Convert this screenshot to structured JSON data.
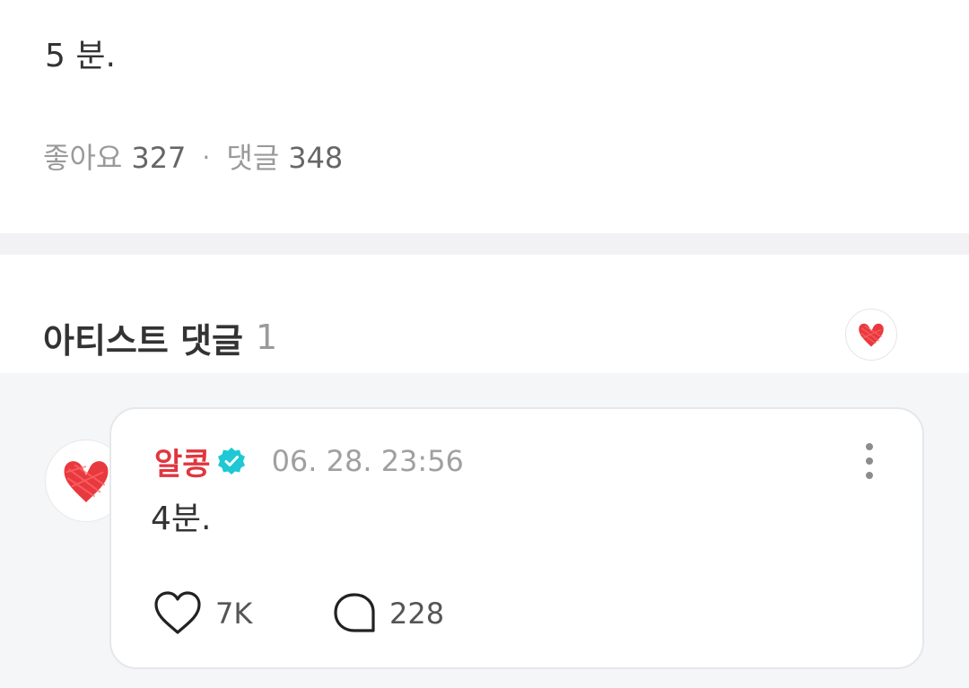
{
  "post": {
    "body_text": "5 분.",
    "likes_label": "좋아요",
    "likes_count": "327",
    "separator": "·",
    "comments_label": "댓글",
    "comments_count": "348"
  },
  "artist_comments": {
    "title": "아티스트 댓글",
    "count": "1",
    "header_avatar_icon": "red-heart-avatar-icon"
  },
  "comments": [
    {
      "author": "알콩",
      "verified_icon": "verified-badge-icon",
      "timestamp": "06. 28. 23:56",
      "text": "4분.",
      "like_icon": "heart-outline-icon",
      "likes": "7K",
      "reply_icon": "speech-bubble-icon",
      "replies": "228",
      "more_icon": "more-vertical-icon"
    }
  ],
  "colors": {
    "author": "#e0363f",
    "verified": "#1ec8d4",
    "heart": "#e8393e",
    "section_bg": "#f5f6f8"
  }
}
